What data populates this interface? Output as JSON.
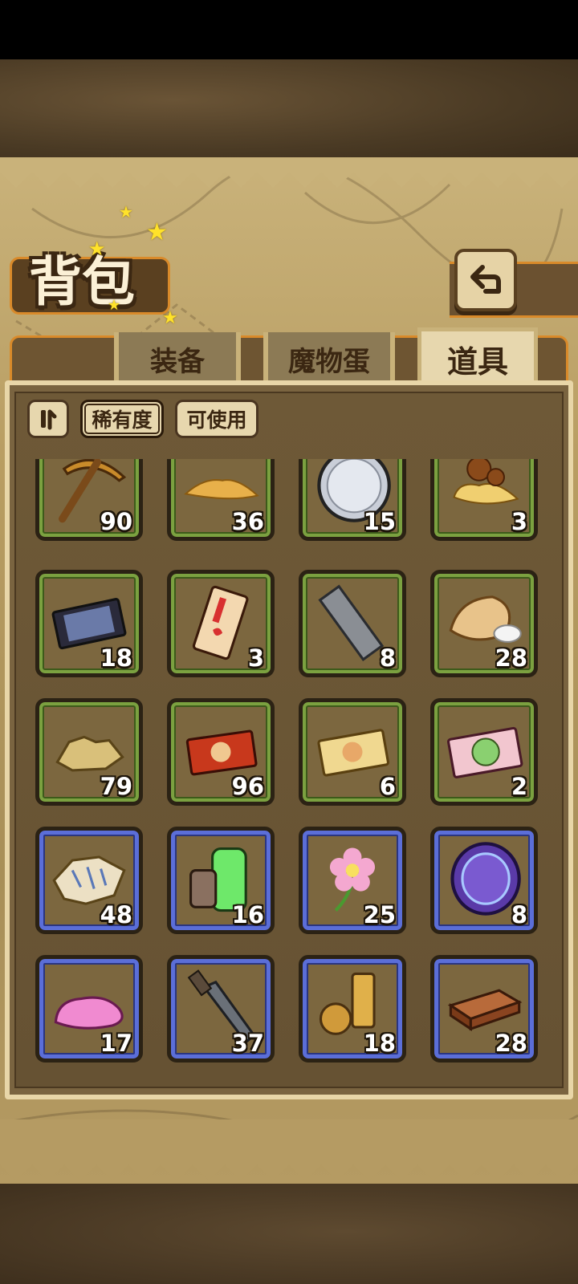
{
  "header": {
    "title": "背包"
  },
  "tabs": [
    {
      "label": "装备",
      "active": false
    },
    {
      "label": "魔物蛋",
      "active": false
    },
    {
      "label": "道具",
      "active": true
    }
  ],
  "filters": {
    "rarity_label": "稀有度",
    "usable_label": "可使用"
  },
  "colors": {
    "common_border": "#7ba140",
    "rare_border": "#5b6ed8"
  },
  "items": [
    {
      "icon": "pickaxe-icon",
      "qty": "90",
      "rarity": "green"
    },
    {
      "icon": "sand-pile-icon",
      "qty": "36",
      "rarity": "green"
    },
    {
      "icon": "silver-coin-icon",
      "qty": "15",
      "rarity": "green"
    },
    {
      "icon": "slime-blob-icon",
      "qty": "3",
      "rarity": "green"
    },
    {
      "icon": "portrait-ticket-icon",
      "qty": "18",
      "rarity": "green"
    },
    {
      "icon": "red-card-icon",
      "qty": "3",
      "rarity": "green"
    },
    {
      "icon": "iron-bar-icon",
      "qty": "8",
      "rarity": "green"
    },
    {
      "icon": "flour-sack-icon",
      "qty": "28",
      "rarity": "green"
    },
    {
      "icon": "gold-nugget-icon",
      "qty": "79",
      "rarity": "green"
    },
    {
      "icon": "red-ticket-icon",
      "qty": "96",
      "rarity": "green"
    },
    {
      "icon": "gold-ticket-icon",
      "qty": "6",
      "rarity": "green"
    },
    {
      "icon": "rainbow-ticket-icon",
      "qty": "2",
      "rarity": "green"
    },
    {
      "icon": "ancient-map-icon",
      "qty": "48",
      "rarity": "blue"
    },
    {
      "icon": "green-canister-icon",
      "qty": "16",
      "rarity": "blue"
    },
    {
      "icon": "pink-flower-icon",
      "qty": "25",
      "rarity": "blue"
    },
    {
      "icon": "purple-rune-coin-icon",
      "qty": "8",
      "rarity": "blue"
    },
    {
      "icon": "pink-slime-icon",
      "qty": "17",
      "rarity": "blue"
    },
    {
      "icon": "broken-sword-icon",
      "qty": "37",
      "rarity": "blue"
    },
    {
      "icon": "golden-relic-icon",
      "qty": "18",
      "rarity": "blue"
    },
    {
      "icon": "wood-plank-icon",
      "qty": "28",
      "rarity": "blue"
    }
  ]
}
